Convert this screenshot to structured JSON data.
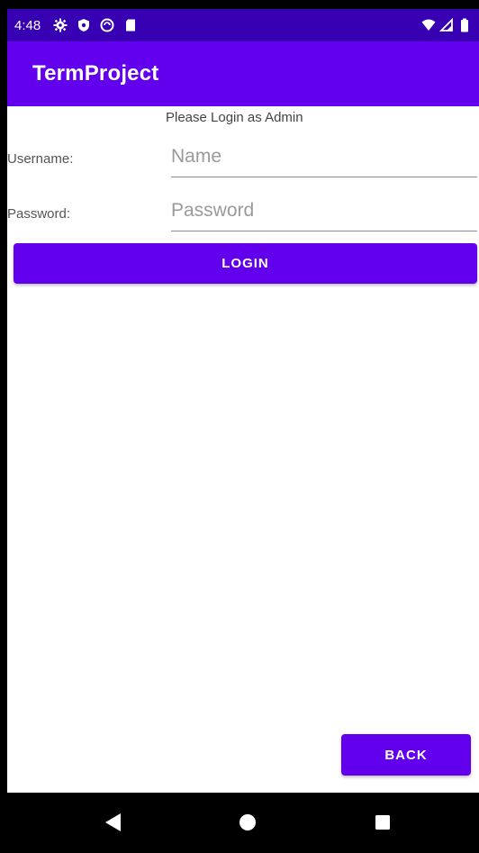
{
  "status_bar": {
    "time": "4:48",
    "icons_left": [
      "gear-icon",
      "shield-icon",
      "sync-icon",
      "sd-card-icon"
    ],
    "icons_right": [
      "wifi-icon",
      "signal-icon",
      "battery-icon"
    ]
  },
  "app_bar": {
    "title": "TermProject"
  },
  "form": {
    "prompt": "Please Login as Admin",
    "username_label": "Username:",
    "username_placeholder": "Name",
    "username_value": "",
    "password_label": "Password:",
    "password_placeholder": "Password",
    "password_value": "",
    "login_label": "LOGIN"
  },
  "footer": {
    "back_label": "BACK"
  },
  "nav_bar": {
    "icons": [
      "back-triangle-icon",
      "home-circle-icon",
      "recents-square-icon"
    ]
  },
  "colors": {
    "primary": "#6200ee",
    "primary_dark": "#3700b3",
    "background": "#ffffff",
    "nav_background": "#000000"
  }
}
